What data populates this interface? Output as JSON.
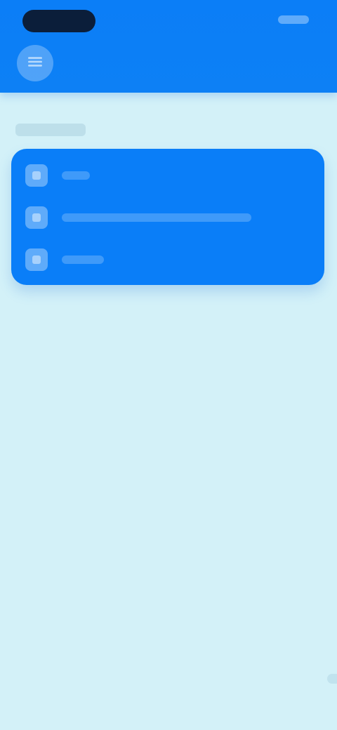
{
  "header": {
    "title": "",
    "menu_icon": "menu-icon"
  },
  "section": {
    "label": ""
  },
  "list": {
    "items": [
      {
        "label": "",
        "icon": "item-icon"
      },
      {
        "label": "",
        "icon": "item-icon"
      },
      {
        "label": "",
        "icon": "item-icon"
      }
    ]
  },
  "colors": {
    "background": "#d3f1f8",
    "accent": "#0b7ef7",
    "card": "#0a7ef8"
  }
}
